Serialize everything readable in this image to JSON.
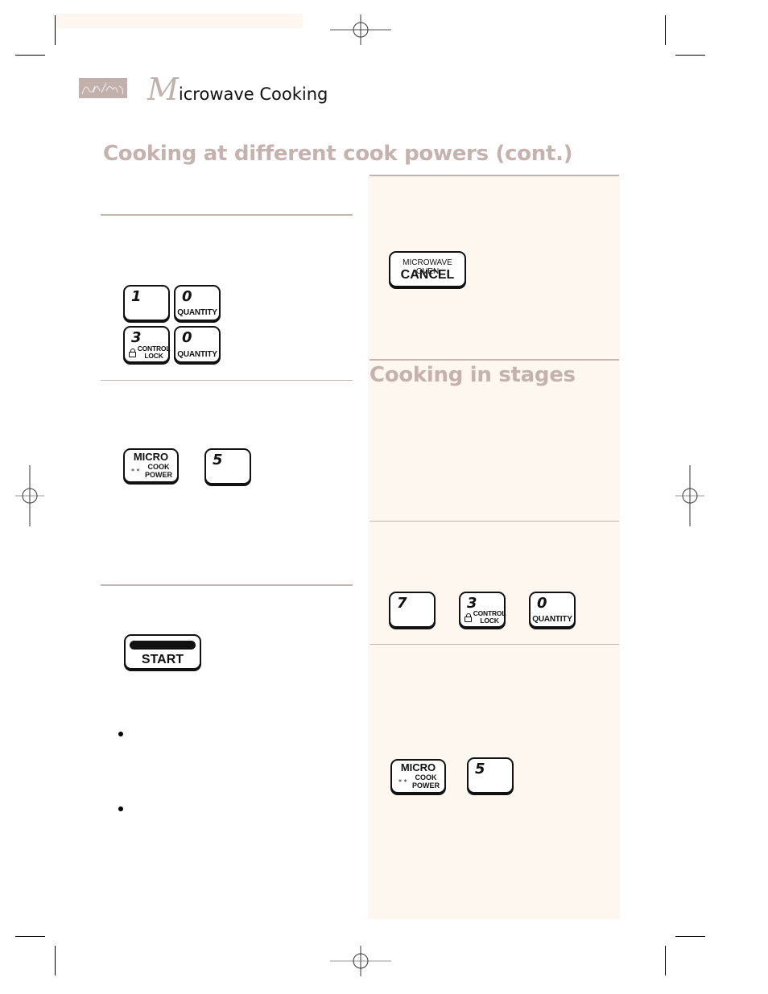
{
  "header": {
    "title_initial": "M",
    "title_rest": "icrowave Cooking",
    "logo": "script-signature-logo"
  },
  "sections": {
    "main_title": "Cooking at different cook powers (cont.)",
    "stages_title": "Cooking in stages"
  },
  "keypads": {
    "step1": [
      {
        "num": "1",
        "sub": ""
      },
      {
        "num": "0",
        "sub": "QUANTITY"
      },
      {
        "num": "3",
        "sub": "CONTROL LOCK",
        "sub1": "CONTROL",
        "sub2": "LOCK",
        "icon": "lock-icon"
      },
      {
        "num": "0",
        "sub": "QUANTITY"
      }
    ],
    "step2": {
      "micro": {
        "top": "MICRO",
        "sub1": "COOK",
        "sub2": "POWER",
        "stars": "* *"
      },
      "digit": "5"
    },
    "step3": {
      "start": "START"
    },
    "cancel": {
      "top": "MICROWAVE OVEN",
      "main": "CANCEL"
    },
    "stages_step1": [
      {
        "num": "7",
        "sub": ""
      },
      {
        "num": "3",
        "sub1": "CONTROL",
        "sub2": "LOCK",
        "icon": "lock-icon"
      },
      {
        "num": "0",
        "sub": "QUANTITY"
      }
    ],
    "stages_step2": {
      "micro": {
        "top": "MICRO",
        "sub1": "COOK",
        "sub2": "POWER",
        "stars": "* *"
      },
      "digit": "5"
    }
  },
  "colors": {
    "accent": "#c5b1ad",
    "panel": "#fdf7f0",
    "text": "#111111"
  }
}
